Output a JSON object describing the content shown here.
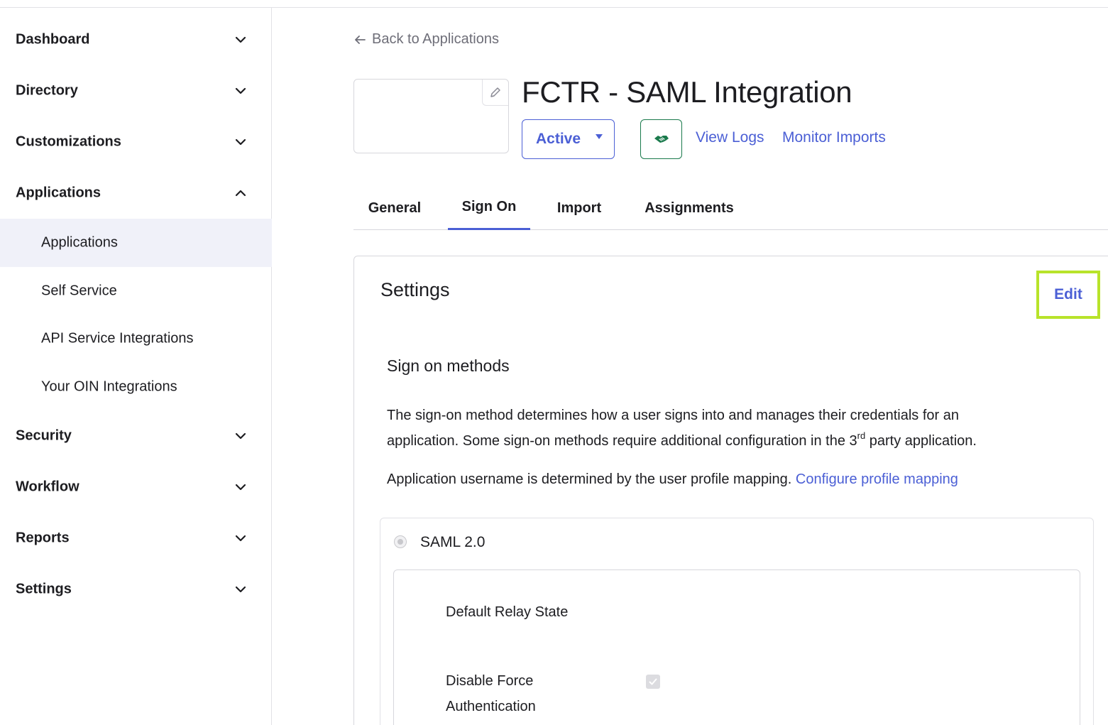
{
  "sidebar": {
    "groups": [
      {
        "label": "Dashboard",
        "expanded": false
      },
      {
        "label": "Directory",
        "expanded": false
      },
      {
        "label": "Customizations",
        "expanded": false
      },
      {
        "label": "Applications",
        "expanded": true
      },
      {
        "label": "Security",
        "expanded": false
      },
      {
        "label": "Workflow",
        "expanded": false
      },
      {
        "label": "Reports",
        "expanded": false
      },
      {
        "label": "Settings",
        "expanded": false
      }
    ],
    "applications_items": [
      {
        "label": "Applications",
        "active": true
      },
      {
        "label": "Self Service",
        "active": false
      },
      {
        "label": "API Service Integrations",
        "active": false
      },
      {
        "label": "Your OIN Integrations",
        "active": false
      }
    ]
  },
  "header": {
    "back_label": "Back to Applications",
    "app_title": "FCTR - SAML Integration",
    "status_label": "Active",
    "view_logs_label": "View Logs",
    "monitor_imports_label": "Monitor Imports"
  },
  "tabs": [
    {
      "label": "General",
      "active": false
    },
    {
      "label": "Sign On",
      "active": true
    },
    {
      "label": "Import",
      "active": false
    },
    {
      "label": "Assignments",
      "active": false
    }
  ],
  "settings": {
    "title": "Settings",
    "edit_label": "Edit",
    "sign_on_methods_title": "Sign on methods",
    "description_line1": "The sign-on method determines how a user signs into and manages their credentials for an",
    "description_line2_a": "application. Some sign-on methods require additional configuration in the 3",
    "description_line2_sup": "rd",
    "description_line2_b": " party application.",
    "username_text": "Application username is determined by the user profile mapping. ",
    "configure_link": "Configure profile mapping",
    "method": {
      "label": "SAML 2.0",
      "selected": true,
      "fields": {
        "relay_state_label": "Default Relay State",
        "disable_force_auth_line1": "Disable Force",
        "disable_force_auth_line2": "Authentication",
        "disable_force_auth_checked": true
      }
    }
  },
  "colors": {
    "accent": "#4b5fd5",
    "edit_highlight": "#b8e32a",
    "push_icon": "#1a7a4c"
  },
  "icons": {
    "back": "arrow-left-icon",
    "logo_edit": "pencil-icon",
    "push_groups": "handshake-icon",
    "status_caret": "caret-down-icon"
  }
}
